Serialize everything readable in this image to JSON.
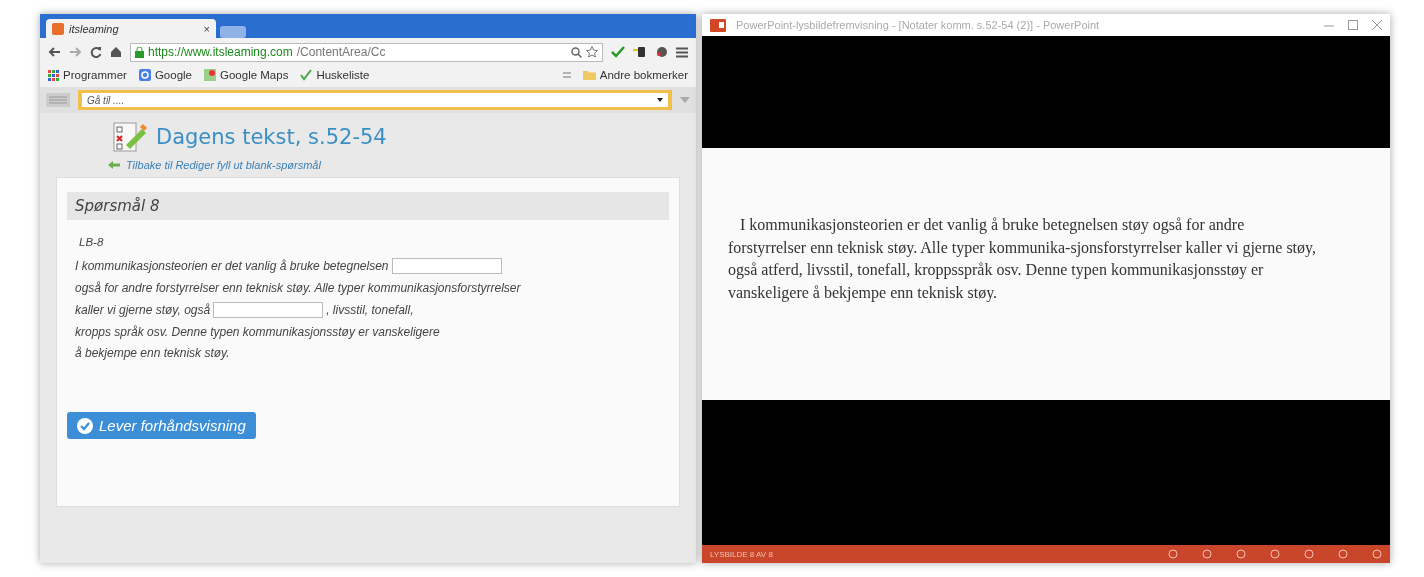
{
  "browser": {
    "tabs": [
      {
        "title": "itsleaming",
        "selected": true,
        "close": "×"
      }
    ],
    "url": {
      "host": "https://www.itsleaming.com",
      "path": "/ContentArea/Cc"
    },
    "bookmarks": [
      {
        "label": "Programmer",
        "kind": "apps"
      },
      {
        "label": "Google",
        "kind": "google"
      },
      {
        "label": "Google Maps",
        "kind": "maps"
      },
      {
        "label": "Huskeliste",
        "kind": "check"
      }
    ],
    "other_bookmarks": "Andre bokmerker",
    "goto": {
      "placeholder": "Gå til ...."
    }
  },
  "page": {
    "title": "Dagens tekst, s.52-54",
    "back_link": "Tilbake til Rediger fyll ut blank-spørsmål",
    "question_title": "Spørsmål 8",
    "question_code": "LB-8",
    "lines": [
      {
        "parts": [
          {
            "kind": "text",
            "text": "I kommunikasjonsteorien er det vanlig å bruke betegnelsen"
          },
          {
            "kind": "blank"
          }
        ]
      },
      {
        "parts": [
          {
            "kind": "text",
            "text": "også for andre forstyrrelser enn teknisk støy. Alle typer kommunikasjonsforstyrrelser"
          }
        ]
      },
      {
        "parts": [
          {
            "kind": "text",
            "text": "kaller vi gjerne støy, også"
          },
          {
            "kind": "blank"
          },
          {
            "kind": "text",
            "text": ", livsstil, tonefall,"
          }
        ]
      },
      {
        "parts": [
          {
            "kind": "text",
            "text": "kropps språk osv. Denne typen kommunikasjonsstøy er vanskeligere"
          }
        ]
      },
      {
        "parts": [
          {
            "kind": "text",
            "text": "å bekjempe enn teknisk støy."
          }
        ]
      }
    ],
    "submit_button": "Lever forhåndsvisning"
  },
  "slideshow": {
    "title": "PowerPoint-lysbildefremvisning - [Notater komm. s.52-54 (2)] - PowerPoint",
    "slide_text": "I kommunikasjonsteorien er det vanlig å bruke betegnelsen støy også for andre forstyrrelser enn teknisk støy. Alle typer kommunika-sjonsforstyrrelser kaller vi gjerne støy, også atferd, livsstil, tonefall, kroppsspråk osv. Denne typen kommunikasjonsstøy er vanskeligere å bekjempe enn teknisk støy.",
    "status": "LYSBILDE 8 AV 8"
  }
}
